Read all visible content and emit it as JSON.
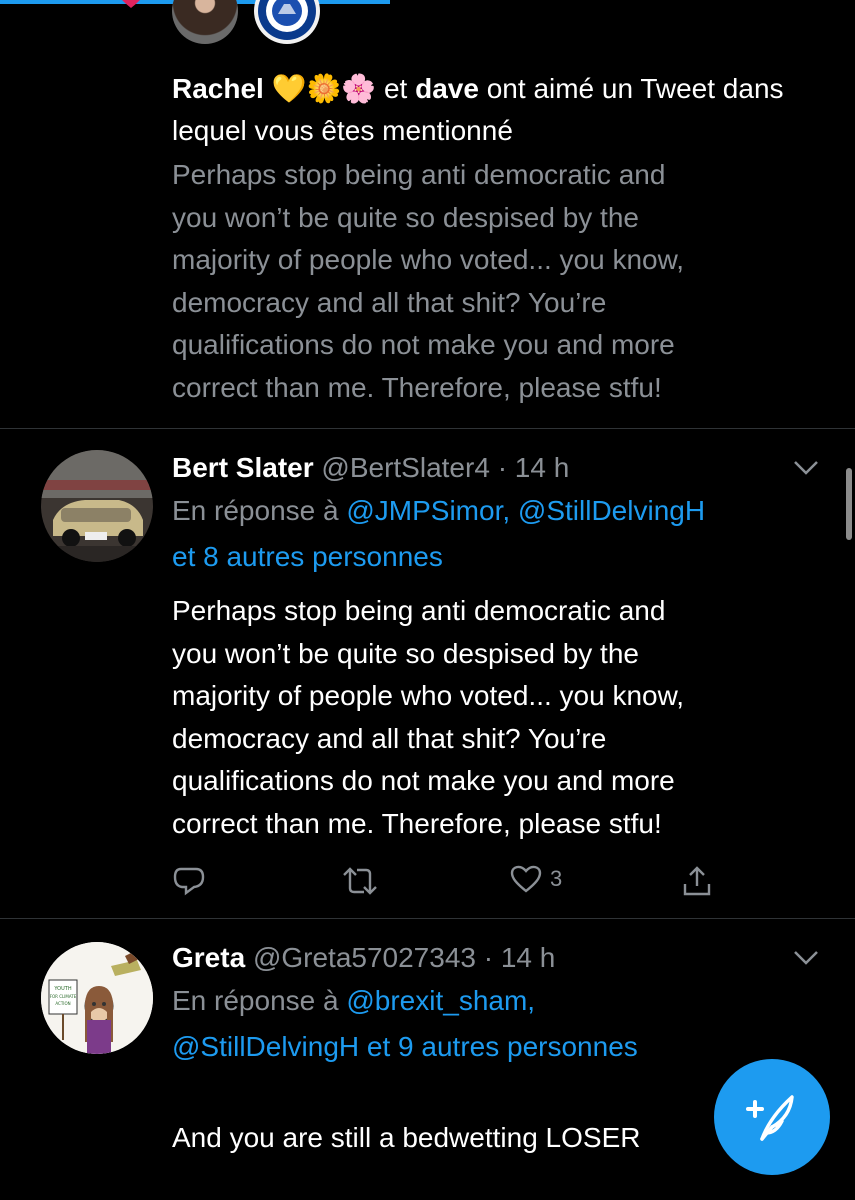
{
  "like_notification": {
    "user1": "Rachel 💛🌼🌸",
    "and_word": "et",
    "user2": "dave",
    "text_rest": "ont aimé un Tweet dans lequel vous êtes mentionné",
    "quote": "Perhaps stop being anti democratic and\nyou won’t be quite so despised by the\nmajority of people who voted... you know,\ndemocracy and all that shit? You’re\nqualifications do not make you and more\ncorrect than me. Therefore, please stfu!"
  },
  "tweets": [
    {
      "name": "Bert Slater",
      "handle": "@BertSlater4",
      "time": "· 14 h",
      "reply_prefix": "En réponse à",
      "reply_mentions": "@JMPSimor, @StillDelvingH\net 8 autres personnes",
      "text": "Perhaps stop being anti democratic and\nyou won’t be quite so despised by the\nmajority of people who voted... you know,\ndemocracy and all that shit? You’re\nqualifications do not make you and more\ncorrect than me. Therefore, please stfu!",
      "like_count": "3"
    },
    {
      "name": "Greta",
      "handle": "@Greta57027343",
      "time": "· 14 h",
      "reply_prefix": "En réponse à",
      "reply_mentions_line1": "@brexit_sham,",
      "reply_mentions_line2": "@StillDelvingH et 9 autres personnes",
      "text": "And you are still a bedwetting LOSER",
      "emojis": "🤣👍",
      "avatar_sign": "YOUTH FOR CLIMATE ACTION"
    }
  ],
  "colors": {
    "accent": "#1d9bf0",
    "secondary_text": "#8b9096",
    "divider": "#2f3336",
    "like_heart": "#e0245e"
  }
}
